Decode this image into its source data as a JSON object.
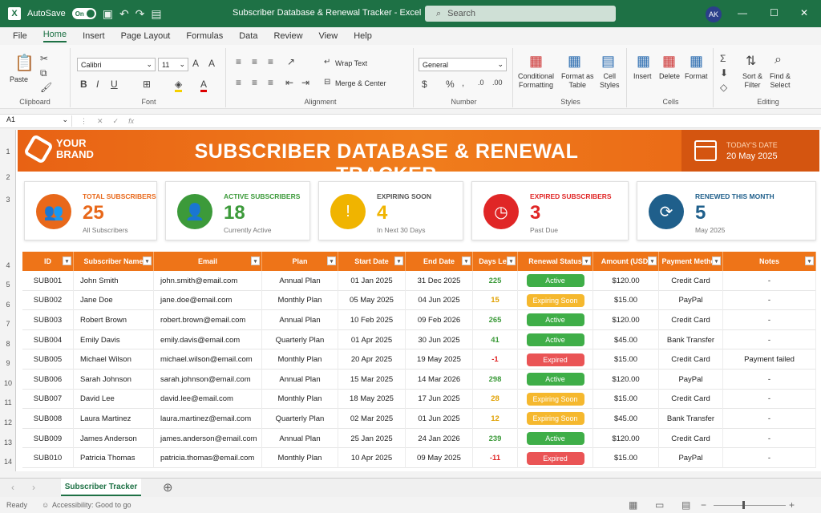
{
  "titlebar": {
    "autosave_label": "AutoSave",
    "autosave_state": "On",
    "title": "Subscriber Database & Renewal Tracker  -  Excel",
    "search_placeholder": "Search",
    "user_initials": "AK"
  },
  "menu": [
    "File",
    "Home",
    "Insert",
    "Page Layout",
    "Formulas",
    "Data",
    "Review",
    "View",
    "Help"
  ],
  "ribbon": {
    "clipboard": {
      "paste": "Paste",
      "label": "Clipboard"
    },
    "font": {
      "name": "Calibri",
      "size": "11",
      "label": "Font"
    },
    "alignment": {
      "wrap": "Wrap Text",
      "merge": "Merge & Center",
      "label": "Alignment"
    },
    "number": {
      "format": "General",
      "label": "Number"
    },
    "styles": {
      "cond1": "Conditional",
      "cond2": "Formatting",
      "fmt1": "Format as",
      "fmt2": "Table",
      "cell1": "Cell",
      "cell2": "Styles",
      "label": "Styles"
    },
    "cells": {
      "insert": "Insert",
      "delete": "Delete",
      "format": "Format",
      "label": "Cells"
    },
    "editing": {
      "sort1": "Sort &",
      "sort2": "Filter",
      "find1": "Find &",
      "find2": "Select",
      "label": "Editing"
    }
  },
  "formula_bar": {
    "cell_ref": "A1",
    "fx": "fx"
  },
  "row_numbers": [
    "1",
    "2",
    "3",
    "4",
    "5",
    "6",
    "7",
    "8",
    "9",
    "10",
    "11",
    "12",
    "13",
    "14"
  ],
  "banner": {
    "brand_line1": "YOUR",
    "brand_line2": "BRAND",
    "title": "SUBSCRIBER DATABASE & RENEWAL TRACKER",
    "date_label": "TODAY'S DATE",
    "date_value": "20 May 2025"
  },
  "cards": [
    {
      "label": "TOTAL SUBSCRIBERS",
      "value": "25",
      "sub": "All Subscribers",
      "color": "#e8681a"
    },
    {
      "label": "ACTIVE SUBSCRIBERS",
      "value": "18",
      "sub": "Currently Active",
      "color": "#3c9a3a"
    },
    {
      "label": "EXPIRING SOON",
      "value": "4",
      "sub": "In Next 30 Days",
      "color": "#f0b400"
    },
    {
      "label": "EXPIRED SUBSCRIBERS",
      "value": "3",
      "sub": "Past Due",
      "color": "#e02626"
    },
    {
      "label": "RENEWED THIS MONTH",
      "value": "5",
      "sub": "May 2025",
      "color": "#1f5f8b"
    }
  ],
  "table": {
    "headers": [
      "ID",
      "Subscriber Name",
      "Email",
      "Plan",
      "Start Date",
      "End Date",
      "Days Left",
      "Renewal Status",
      "Amount (USD)",
      "Payment Method",
      "Notes"
    ],
    "rows": [
      [
        "SUB001",
        "John Smith",
        "john.smith@email.com",
        "Annual Plan",
        "01 Jan 2025",
        "31 Dec 2025",
        "225",
        "Active",
        "$120.00",
        "Credit Card",
        "-"
      ],
      [
        "SUB002",
        "Jane Doe",
        "jane.doe@email.com",
        "Monthly Plan",
        "05 May 2025",
        "04 Jun 2025",
        "15",
        "Expiring Soon",
        "$15.00",
        "PayPal",
        "-"
      ],
      [
        "SUB003",
        "Robert Brown",
        "robert.brown@email.com",
        "Annual Plan",
        "10 Feb 2025",
        "09 Feb 2026",
        "265",
        "Active",
        "$120.00",
        "Credit Card",
        "-"
      ],
      [
        "SUB004",
        "Emily Davis",
        "emily.davis@email.com",
        "Quarterly Plan",
        "01 Apr 2025",
        "30 Jun 2025",
        "41",
        "Active",
        "$45.00",
        "Bank Transfer",
        "-"
      ],
      [
        "SUB005",
        "Michael Wilson",
        "michael.wilson@email.com",
        "Monthly Plan",
        "20 Apr 2025",
        "19 May 2025",
        "-1",
        "Expired",
        "$15.00",
        "Credit Card",
        "Payment failed"
      ],
      [
        "SUB006",
        "Sarah Johnson",
        "sarah.johnson@email.com",
        "Annual Plan",
        "15 Mar 2025",
        "14 Mar 2026",
        "298",
        "Active",
        "$120.00",
        "PayPal",
        "-"
      ],
      [
        "SUB007",
        "David Lee",
        "david.lee@email.com",
        "Monthly Plan",
        "18 May 2025",
        "17 Jun 2025",
        "28",
        "Expiring Soon",
        "$15.00",
        "Credit Card",
        "-"
      ],
      [
        "SUB008",
        "Laura Martinez",
        "laura.martinez@email.com",
        "Quarterly Plan",
        "02 Mar 2025",
        "01 Jun 2025",
        "12",
        "Expiring Soon",
        "$45.00",
        "Bank Transfer",
        "-"
      ],
      [
        "SUB009",
        "James Anderson",
        "james.anderson@email.com",
        "Annual Plan",
        "25 Jan 2025",
        "24 Jan 2026",
        "239",
        "Active",
        "$120.00",
        "Credit Card",
        "-"
      ],
      [
        "SUB010",
        "Patricia Thomas",
        "patricia.thomas@email.com",
        "Monthly Plan",
        "10 Apr 2025",
        "09 May 2025",
        "-11",
        "Expired",
        "$15.00",
        "PayPal",
        "-"
      ]
    ]
  },
  "status_colors": {
    "Active": "#3fae48",
    "Expiring Soon": "#f5b82e",
    "Expired": "#ea5455"
  },
  "sheet_tab": "Subscriber Tracker",
  "status": {
    "ready": "Ready",
    "accessibility": "Accessibility: Good to go"
  }
}
